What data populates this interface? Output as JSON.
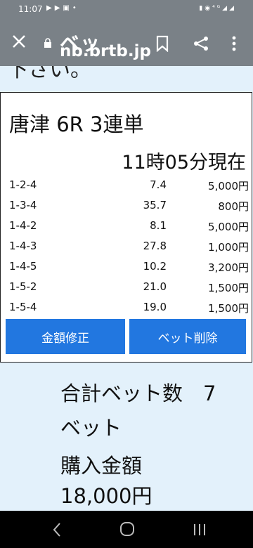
{
  "status_bar": {
    "time": "11:07"
  },
  "toolbar": {
    "title_overlay": "ベッ",
    "url": "nb.brtb.jp"
  },
  "page": {
    "partial_text": "下さい。",
    "race_title": "唐津 6R 3連単",
    "timestamp": "11時05分現在",
    "rows": [
      {
        "combo": "1-2-4",
        "odds": "7.4",
        "amount": "5,000円"
      },
      {
        "combo": "1-3-4",
        "odds": "35.7",
        "amount": "800円"
      },
      {
        "combo": "1-4-2",
        "odds": "8.1",
        "amount": "5,000円"
      },
      {
        "combo": "1-4-3",
        "odds": "27.8",
        "amount": "1,000円"
      },
      {
        "combo": "1-4-5",
        "odds": "10.2",
        "amount": "3,200円"
      },
      {
        "combo": "1-5-2",
        "odds": "21.0",
        "amount": "1,500円"
      },
      {
        "combo": "1-5-4",
        "odds": "19.0",
        "amount": "1,500円"
      }
    ],
    "edit_button": "金額修正",
    "delete_button": "ベット削除",
    "total_bets_line1": "合計ベット数　7",
    "total_bets_line2": "ベット",
    "purchase_label": "購入金額",
    "purchase_amount": "18,000円"
  }
}
